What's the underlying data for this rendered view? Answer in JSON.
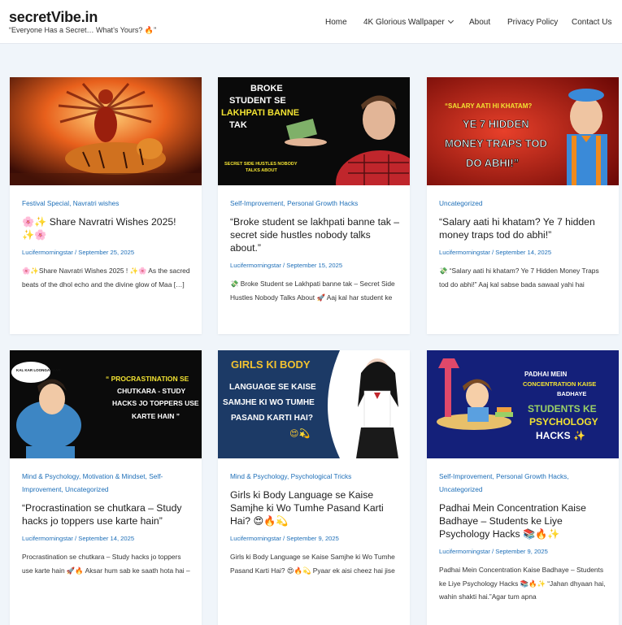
{
  "site": {
    "title": "secretVibe.in",
    "tagline": "“Everyone Has a Secret… What’s Yours? 🔥”"
  },
  "nav": {
    "items": [
      {
        "label": "Home"
      },
      {
        "label": "4K Glorious Wallpaper",
        "has_dropdown": true
      },
      {
        "label": "About"
      },
      {
        "label": "Privacy Policy"
      },
      {
        "label": "Contact Us"
      }
    ]
  },
  "colors": {
    "accent": "#1e6fb8",
    "background": "#f0f5fa",
    "card": "#ffffff"
  },
  "posts": [
    {
      "image_text": [],
      "categories": [
        "Festival Special",
        "Navratri wishes"
      ],
      "title": "🌸✨ Share Navratri Wishes 2025! ✨🌸",
      "author": "Lucifermorningstar",
      "date": "September 25, 2025",
      "excerpt": "🌸✨Share Navratri Wishes 2025 ! ✨🌸 As the sacred beats of the dhol echo and the divine glow of Maa […]"
    },
    {
      "image_text": [
        "BROKE",
        "STUDENT SE",
        "LAKHPATI BANNE",
        "TAK",
        "SECRET SIDE HUSTLES NOBODY",
        "TALKS ABOUT"
      ],
      "categories": [
        "Self-Improvement",
        "Personal Growth Hacks"
      ],
      "title": "“Broke student se lakhpati banne tak – secret side hustles nobody talks about.”",
      "author": "Lucifermorningstar",
      "date": "September 15, 2025",
      "excerpt": "💸 Broke Student se Lakhpati banne tak – Secret Side Hustles Nobody Talks About 🚀 Aaj kal har student ke"
    },
    {
      "image_text": [
        "“SALARY AATI HI KHATAM?",
        "YE 7 HIDDEN",
        "MONEY TRAPS TOD",
        "DO ABHI!”"
      ],
      "categories": [
        "Uncategorized"
      ],
      "title": "“Salary aati hi khatam? Ye 7 hidden money traps tod do abhi!”",
      "author": "Lucifermorningstar",
      "date": "September 14, 2025",
      "excerpt": "💸 “Salary aati hi khatam? Ye 7 Hidden Money Traps tod do abhi!” Aaj kal sabse bada sawaal yahi hai"
    },
    {
      "image_text": [
        "KAL KAR LOONGA YAAR",
        "“ PROCRASTINATION SE",
        "CHUTKARA - STUDY",
        "HACKS JO TOPPERS USE",
        "KARTE HAIN ”"
      ],
      "categories": [
        "Mind & Psychology",
        "Motivation & Mindset",
        "Self-Improvement",
        "Uncategorized"
      ],
      "title": "“Procrastination se chutkara – Study hacks jo toppers use karte hain”",
      "author": "Lucifermorningstar",
      "date": "September 14, 2025",
      "excerpt": "Procrastination se chutkara – Study hacks jo toppers use karte hain 🚀🔥 Aksar hum sab ke saath hota hai –"
    },
    {
      "image_text": [
        "GIRLS KI BODY",
        "LANGUAGE SE KAISE",
        "SAMJHE KI WO TUMHE",
        "PASAND KARTI HAI?",
        "😍💫"
      ],
      "categories": [
        "Mind & Psychology",
        "Psychological Tricks"
      ],
      "title": "Girls ki Body Language se Kaise Samjhe ki Wo Tumhe Pasand Karti Hai? 😍🔥💫",
      "author": "Lucifermorningstar",
      "date": "September 9, 2025",
      "excerpt": "Girls ki Body Language se Kaise Samjhe ki Wo Tumhe Pasand Karti Hai? 😍🔥💫 Pyaar ek aisi cheez hai jise"
    },
    {
      "image_text": [
        "PADHAI MEIN",
        "CONCENTRATION KAISE",
        "BADHAYE",
        "STUDENTS KE",
        "PSYCHOLOGY",
        "HACKS ✨"
      ],
      "categories": [
        "Self-Improvement",
        "Personal Growth Hacks",
        "Uncategorized"
      ],
      "title": "Padhai Mein Concentration Kaise Badhaye – Students ke Liye Psychology Hacks 📚🔥✨",
      "author": "Lucifermorningstar",
      "date": "September 9, 2025",
      "excerpt": "Padhai Mein Concentration Kaise Badhaye – Students ke Liye Psychology Hacks 📚🔥✨ “Jahan dhyaan hai, wahin shakti hai.”Agar tum apna"
    }
  ]
}
